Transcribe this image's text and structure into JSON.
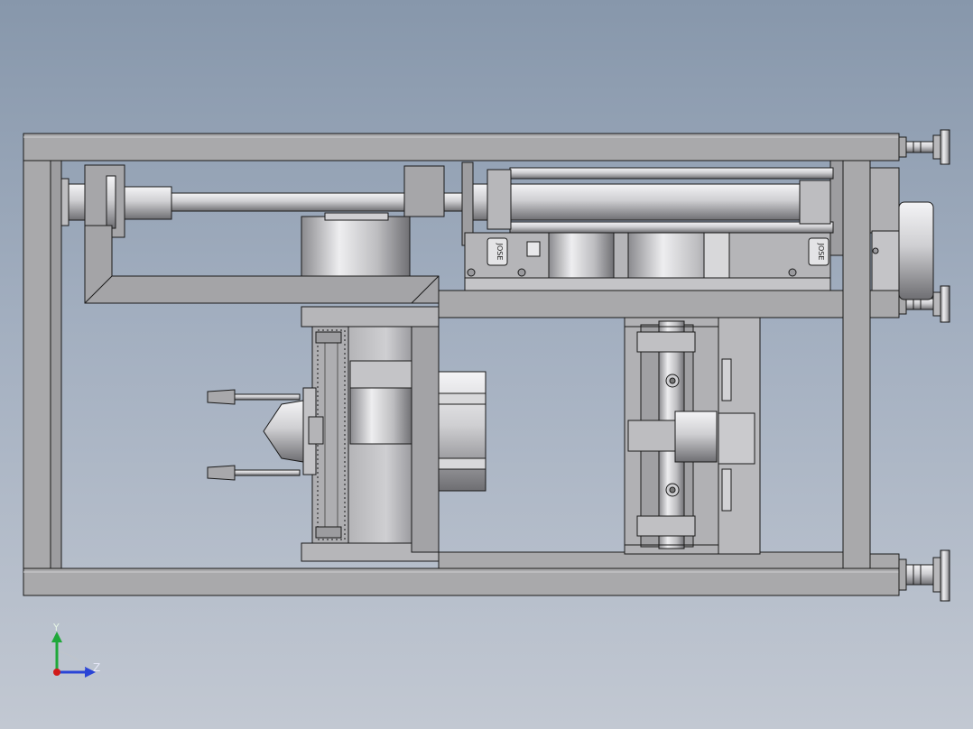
{
  "view": {
    "background_top": "#8797ab",
    "background_bottom": "#c2c8d2"
  },
  "labels": {
    "nameplate_left": "JOSE",
    "nameplate_right": "JOSE"
  },
  "triad": {
    "y_label": "Y",
    "z_label": "Z",
    "y_color": "#1fa83a",
    "z_color": "#2a44d6",
    "x_color": "#d11a1a"
  },
  "colors": {
    "frame_fill": "#a9a9ab",
    "frame_stroke": "#1a1a1a",
    "metal_light": "#e2e2e4",
    "metal_mid": "#b8b8bb",
    "metal_dark": "#7c7c80"
  }
}
